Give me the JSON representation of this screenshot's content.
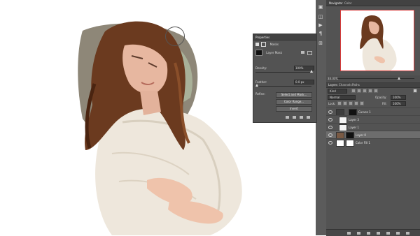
{
  "navigator": {
    "tab_navigator": "Navigator",
    "tab_color": "Color",
    "zoom": "33.33%"
  },
  "properties": {
    "title": "Properties",
    "masks_label": "Masks",
    "layer_mask_label": "Layer Mask",
    "density_label": "Density:",
    "density_value": "100%",
    "feather_label": "Feather:",
    "feather_value": "0.0 px",
    "refine_label": "Refine:",
    "select_mask_button": "Select and Mask...",
    "color_range_button": "Color Range...",
    "invert_button": "Invert"
  },
  "layers": {
    "tab_layers": "Layers",
    "tab_channels": "Channels",
    "tab_paths": "Paths",
    "kind_label": "Kind",
    "blend_mode": "Normal",
    "opacity_label": "Opacity:",
    "opacity_value": "100%",
    "lock_label": "Lock:",
    "fill_label": "Fill:",
    "fill_value": "100%",
    "items": [
      {
        "name": "Curves 1"
      },
      {
        "name": "Layer 3"
      },
      {
        "name": "Layer 1"
      },
      {
        "name": "Layer 0"
      },
      {
        "name": "Color Fill 1"
      }
    ]
  }
}
